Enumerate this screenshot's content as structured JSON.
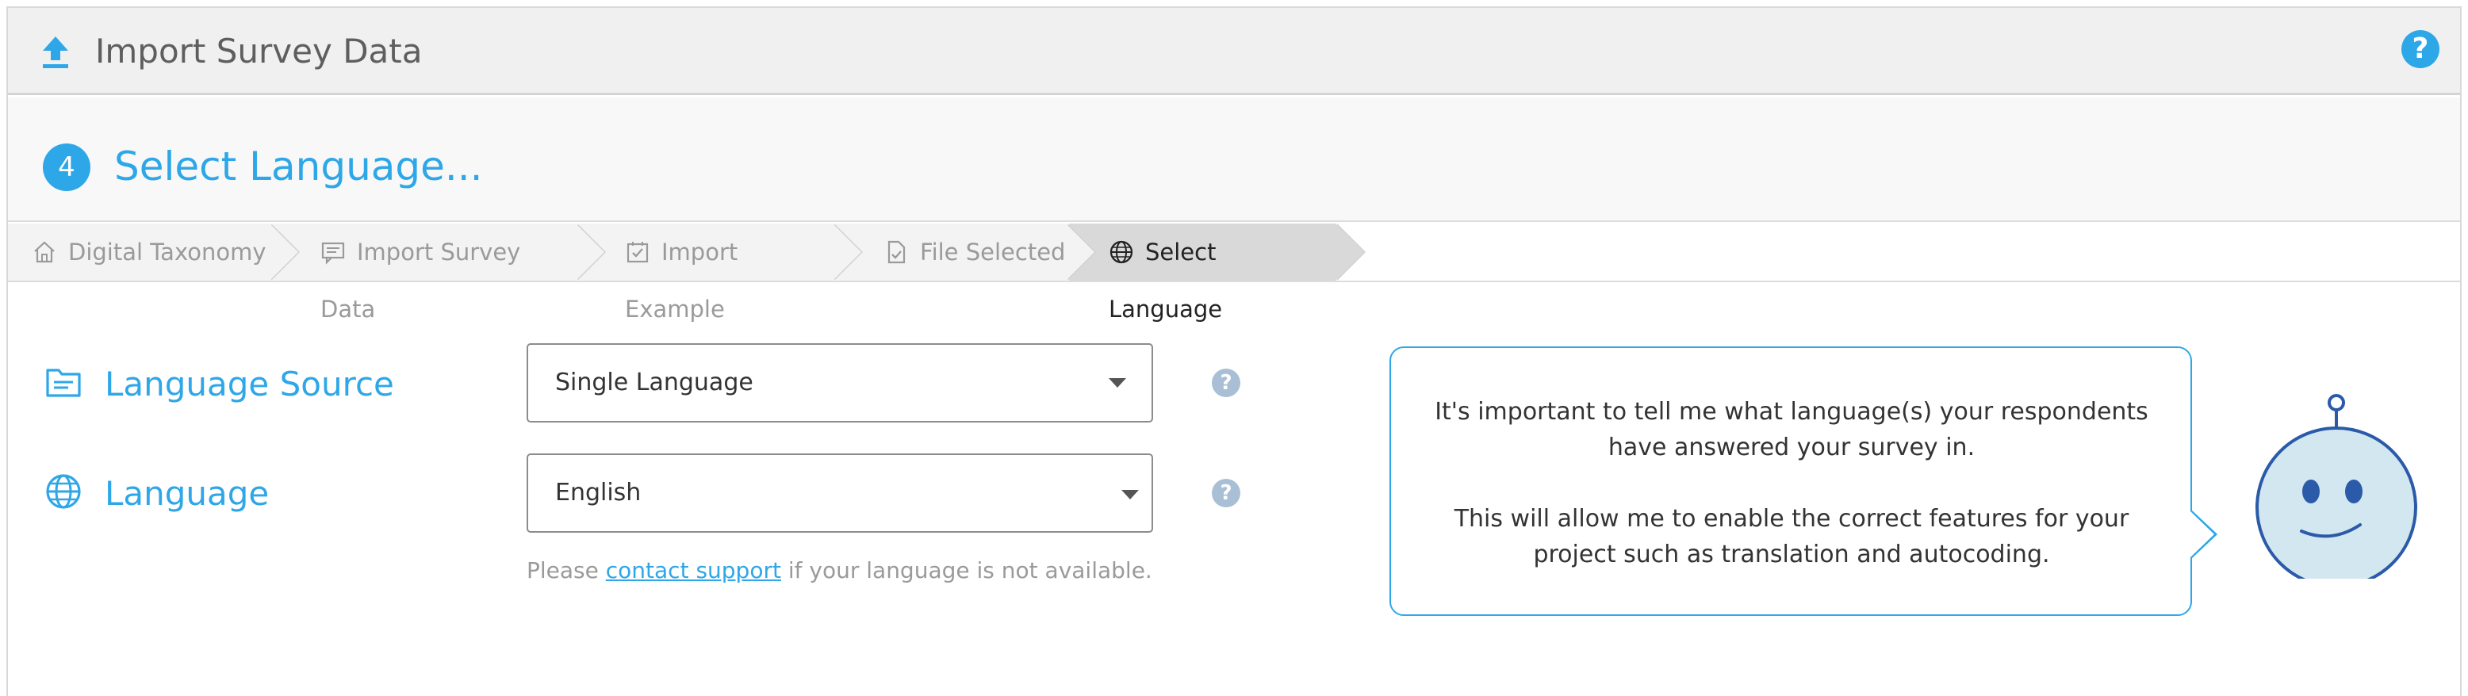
{
  "header": {
    "title": "Import Survey Data",
    "help_label": "?",
    "accent_color": "#2ea7e8"
  },
  "step": {
    "number": "4",
    "title": "Select Language..."
  },
  "breadcrumb": [
    {
      "label": "Digital Taxonomy",
      "icon": "home-icon"
    },
    {
      "label": "Import Survey Data",
      "icon": "survey-icon"
    },
    {
      "label": "Import Example",
      "icon": "checkbox-icon"
    },
    {
      "label": "File Selected",
      "icon": "file-check-icon"
    },
    {
      "label": "Select Language",
      "icon": "globe-icon",
      "active": true
    }
  ],
  "form": {
    "language_source": {
      "label": "Language Source",
      "icon": "folder-icon",
      "value": "Single Language",
      "help": "?"
    },
    "language": {
      "label": "Language",
      "icon": "globe-icon",
      "value": "English",
      "help": "?"
    },
    "note": {
      "prefix": "Please ",
      "link": "contact support",
      "suffix": " if your language is not available."
    }
  },
  "assistant": {
    "paragraph1": "It's important to tell me what language(s) your respondents have answered your survey in.",
    "paragraph2": "This will allow me to enable the correct features for your project such as translation and autocoding."
  }
}
